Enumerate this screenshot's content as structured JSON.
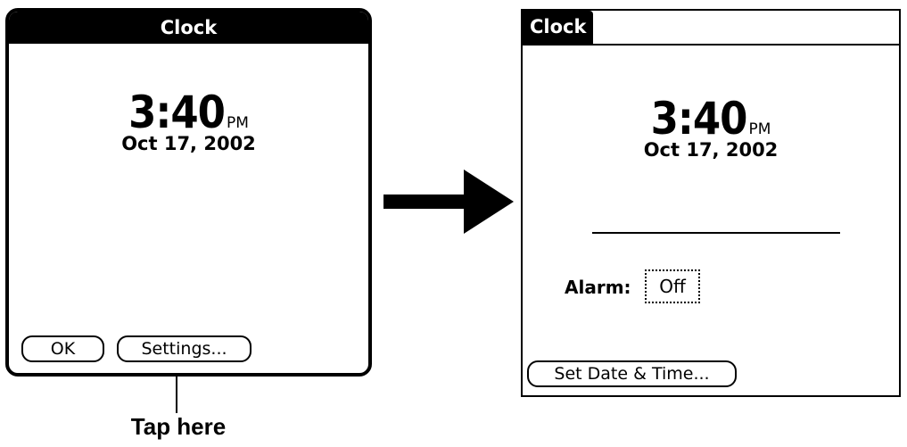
{
  "clock_modal": {
    "title": "Clock",
    "time": "3:40",
    "ampm": "PM",
    "date": "Oct 17, 2002",
    "ok_label": "OK",
    "settings_label": "Settings..."
  },
  "clock_app": {
    "title": "Clock",
    "time": "3:40",
    "ampm": "PM",
    "date": "Oct 17, 2002",
    "alarm_label": "Alarm:",
    "alarm_value": "Off",
    "set_date_time_label": "Set Date & Time..."
  },
  "callout": {
    "text": "Tap here"
  }
}
